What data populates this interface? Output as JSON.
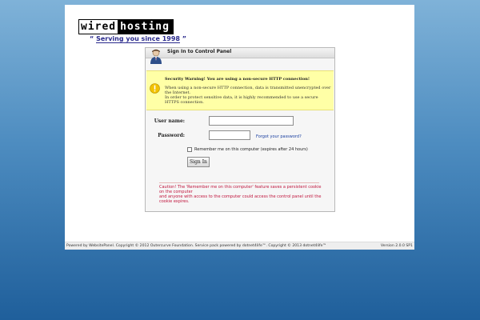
{
  "logo": {
    "word1": "wired",
    "word2": "hosting",
    "tagline_open": "“",
    "tagline": "Serving you since 1998",
    "tagline_close": "”"
  },
  "panel": {
    "title": "Sign In to Control Panel",
    "warning": {
      "title": "Security Warning! You are using a non-secure HTTP connection!",
      "line1": "When using a non-secure HTTP connection, data is transmitted unencrypted over the Internet.",
      "line2": "In order to protect sensitive data, it is highly recommended to use a secure HTTPS connection."
    },
    "username_label": "User name:",
    "username_value": "",
    "password_label": "Password:",
    "password_value": "",
    "forgot_link": "Forgot your password?",
    "remember_label": "Remember me on this computer (expires after 24 hours)",
    "signin_button": "Sign In",
    "caution": {
      "line1": "Caution! The 'Remember me on this computer' feature saves a persistent cookie on the computer",
      "line2": "and anyone with access to the computer could access the control panel until the cookie expires."
    }
  },
  "footer": {
    "left": "Powered by WebsitePanel. Copyright © 2012 Outercurve Foundation. Service pack powered by dotnet4life™. Copyright © 2013 dotnet4life™",
    "right": "Version 2.0.0 SP1"
  }
}
